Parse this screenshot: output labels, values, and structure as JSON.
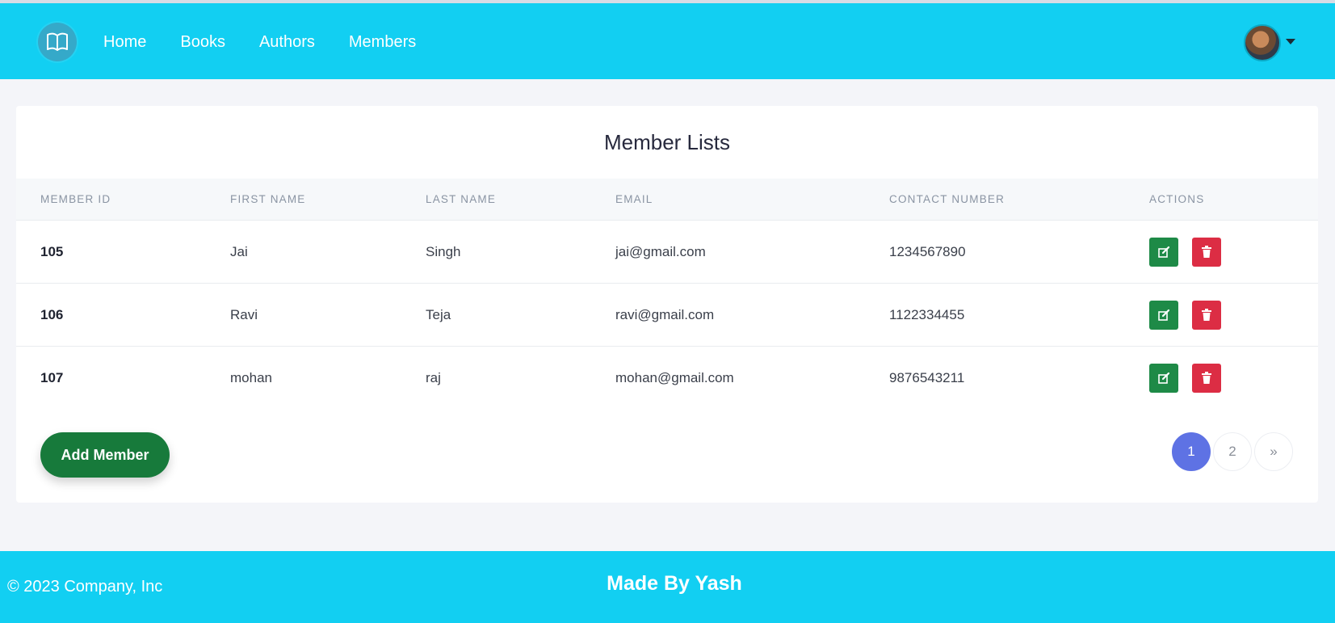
{
  "nav": {
    "brand_icon": "book-open-icon",
    "links": [
      "Home",
      "Books",
      "Authors",
      "Members"
    ],
    "user_avatar_icon": "user-avatar",
    "dropdown_icon": "caret-down-icon"
  },
  "main": {
    "title": "Member Lists",
    "columns": [
      "MEMBER ID",
      "FIRST NAME",
      "LAST NAME",
      "EMAIL",
      "CONTACT NUMBER",
      "ACTIONS"
    ],
    "rows": [
      {
        "id": "105",
        "first": "Jai",
        "last": "Singh",
        "email": "jai@gmail.com",
        "contact": "1234567890"
      },
      {
        "id": "106",
        "first": "Ravi",
        "last": "Teja",
        "email": "ravi@gmail.com",
        "contact": "1122334455"
      },
      {
        "id": "107",
        "first": "mohan",
        "last": "raj",
        "email": "mohan@gmail.com",
        "contact": "9876543211"
      }
    ],
    "row_actions": {
      "edit_icon": "edit-icon",
      "delete_icon": "trash-icon"
    },
    "add_button": "Add Member",
    "pagination": {
      "pages": [
        "1",
        "2"
      ],
      "next": "»",
      "current": "1"
    }
  },
  "footer": {
    "copyright": "© 2023 Company, Inc",
    "credit": "Made By Yash"
  },
  "colors": {
    "navbar": "#12cff2",
    "edit": "#1e8a47",
    "delete": "#dc2d44",
    "add_button": "#177a3b",
    "page_active": "#5e72e4"
  }
}
